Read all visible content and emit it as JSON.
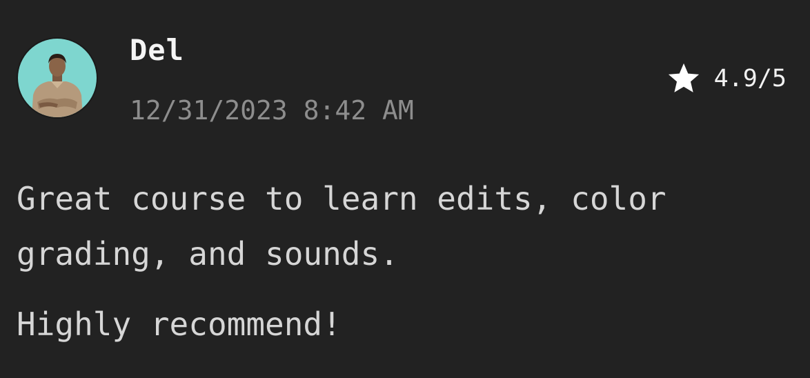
{
  "review": {
    "author": "Del",
    "timestamp": "12/31/2023 8:42 AM",
    "rating_display": "4.9/5",
    "rating_value": 4.9,
    "rating_max": 5,
    "body_lines": [
      "Great course to learn edits, color",
      "grading, and sounds."
    ],
    "closing": "Highly recommend!"
  },
  "icons": {
    "rating": "star-icon",
    "avatar": "user-avatar-photo"
  },
  "colors": {
    "background": "#222222",
    "author_text": "#f5f5f5",
    "timestamp_text": "#8d8d8d",
    "body_text": "#d6d6d6",
    "avatar_bg": "#7ed6cf"
  }
}
